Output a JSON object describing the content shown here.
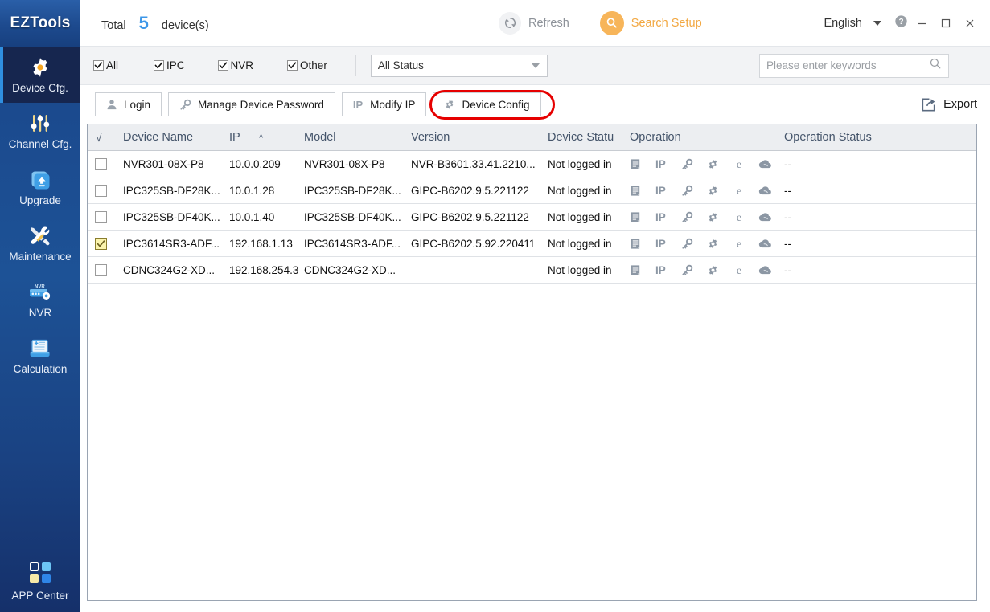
{
  "brand": {
    "name": "EZTools"
  },
  "header": {
    "total_label": "Total",
    "total_count": "5",
    "total_unit": "device(s)",
    "refresh_label": "Refresh",
    "refresh_icon": "refresh-icon",
    "search_setup_label": "Search Setup",
    "search_setup_icon": "search-setup-icon",
    "language": "English",
    "help_icon": "help-icon",
    "minimize_icon": "minimize-icon",
    "maximize_icon": "maximize-icon",
    "close_icon": "close-icon",
    "accent_blue": "#3d97e8",
    "accent_orange": "#f2a740"
  },
  "sidebar": {
    "items": [
      {
        "label": "Device Cfg.",
        "icon": "gear-icon",
        "active": true
      },
      {
        "label": "Channel Cfg.",
        "icon": "sliders-icon",
        "active": false
      },
      {
        "label": "Upgrade",
        "icon": "upload-icon",
        "active": false
      },
      {
        "label": "Maintenance",
        "icon": "tools-icon",
        "active": false
      },
      {
        "label": "NVR",
        "icon": "nvr-icon",
        "active": false
      },
      {
        "label": "Calculation",
        "icon": "calculator-icon",
        "active": false
      }
    ],
    "app_center": {
      "label": "APP Center",
      "icon": "grid-icon"
    }
  },
  "filters": {
    "checkboxes": [
      {
        "label": "All",
        "checked": true
      },
      {
        "label": "IPC",
        "checked": true
      },
      {
        "label": "NVR",
        "checked": true
      },
      {
        "label": "Other",
        "checked": true
      }
    ],
    "status_select": {
      "value": "All Status",
      "options": [
        "All Status"
      ]
    },
    "search": {
      "placeholder": "Please enter keywords",
      "value": "",
      "icon": "search-icon"
    }
  },
  "toolbar": {
    "buttons": [
      {
        "label": "Login",
        "icon": "user-icon",
        "highlighted": false
      },
      {
        "label": "Manage Device Password",
        "icon": "key-icon",
        "highlighted": false
      },
      {
        "label": "Modify IP",
        "icon": "ip-text-icon",
        "highlighted": true
      },
      {
        "label": "Device Config",
        "icon": "gear-icon",
        "highlighted": false
      }
    ],
    "export": {
      "label": "Export",
      "icon": "export-icon"
    },
    "highlight_color": "#e60000"
  },
  "table": {
    "columns": [
      {
        "key": "check",
        "label": "√"
      },
      {
        "key": "name",
        "label": "Device Name"
      },
      {
        "key": "ip",
        "label": "IP",
        "sorted": "asc"
      },
      {
        "key": "model",
        "label": "Model"
      },
      {
        "key": "version",
        "label": "Version"
      },
      {
        "key": "devstatus",
        "label": "Device Statu"
      },
      {
        "key": "operation",
        "label": "Operation"
      },
      {
        "key": "opstatus",
        "label": "Operation Status"
      }
    ],
    "operation_icons": [
      "document-icon",
      "ip-text-icon",
      "key-icon",
      "gear-icon",
      "edge-browser-icon",
      "cloud-icon"
    ],
    "rows": [
      {
        "selected": false,
        "name": "NVR301-08X-P8",
        "ip": "10.0.0.209",
        "model": "NVR301-08X-P8",
        "version": "NVR-B3601.33.41.2210...",
        "devstatus": "Not logged in",
        "opstatus": "--"
      },
      {
        "selected": false,
        "name": "IPC325SB-DF28K...",
        "ip": "10.0.1.28",
        "model": "IPC325SB-DF28K...",
        "version": "GIPC-B6202.9.5.221122",
        "devstatus": "Not logged in",
        "opstatus": "--"
      },
      {
        "selected": false,
        "name": "IPC325SB-DF40K...",
        "ip": "10.0.1.40",
        "model": "IPC325SB-DF40K...",
        "version": "GIPC-B6202.9.5.221122",
        "devstatus": "Not logged in",
        "opstatus": "--"
      },
      {
        "selected": true,
        "name": "IPC3614SR3-ADF...",
        "ip": "192.168.1.13",
        "model": "IPC3614SR3-ADF...",
        "version": "GIPC-B6202.5.92.220411",
        "devstatus": "Not logged in",
        "opstatus": "--"
      },
      {
        "selected": false,
        "name": "CDNC324G2-XD...",
        "ip": "192.168.254.3",
        "model": "CDNC324G2-XD...",
        "version": "",
        "devstatus": "Not logged in",
        "opstatus": "--"
      }
    ]
  }
}
